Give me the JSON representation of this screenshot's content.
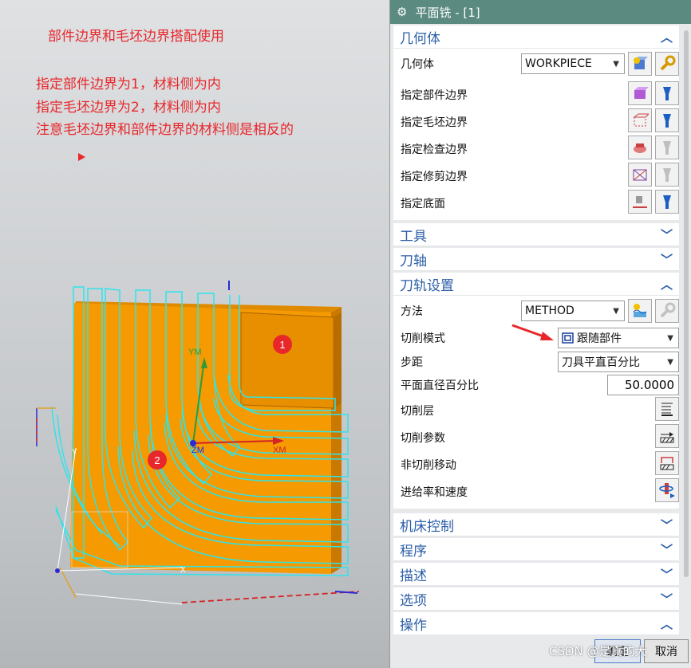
{
  "annotations": {
    "title": "部件边界和毛坯边界搭配使用",
    "line1": "指定部件边界为1，材料侧为内",
    "line2": "指定毛坯边界为2，材料侧为内",
    "line3": "注意毛坯边界和部件边界的材料侧是相反的"
  },
  "viewport": {
    "badge1": "1",
    "badge2": "2",
    "axis_ym": "YM",
    "axis_xm": "XM",
    "axis_zm": "ZM",
    "axis_y": "Y",
    "axis_x": "X"
  },
  "dialog": {
    "title": "平面铣 - [1]",
    "geometry": {
      "header": "几何体",
      "geometry_label": "几何体",
      "geometry_value": "WORKPIECE",
      "part_boundary": "指定部件边界",
      "blank_boundary": "指定毛坯边界",
      "check_boundary": "指定检查边界",
      "trim_boundary": "指定修剪边界",
      "floor": "指定底面"
    },
    "tool": {
      "header": "工具"
    },
    "axis": {
      "header": "刀轴"
    },
    "path": {
      "header": "刀轨设置",
      "method_label": "方法",
      "method_value": "METHOD",
      "cut_pattern_label": "切削模式",
      "cut_pattern_value": "跟随部件",
      "stepover_label": "步距",
      "stepover_value": "刀具平直百分比",
      "percent_label": "平面直径百分比",
      "percent_value": "50.0000",
      "cut_levels": "切削层",
      "cut_params": "切削参数",
      "noncut_moves": "非切削移动",
      "feeds_speeds": "进给率和速度"
    },
    "machine": {
      "header": "机床控制"
    },
    "program": {
      "header": "程序"
    },
    "description": {
      "header": "描述"
    },
    "options": {
      "header": "选项"
    },
    "actions": {
      "header": "操作"
    },
    "ok": "确定",
    "cancel": "取消"
  },
  "watermark": "CSDN @是真的大"
}
